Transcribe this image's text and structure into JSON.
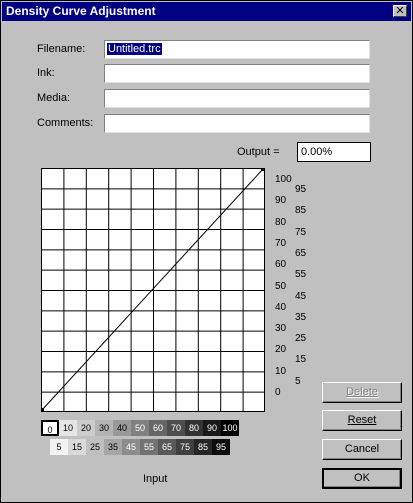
{
  "window": {
    "title": "Density Curve Adjustment",
    "close_glyph": "✕"
  },
  "fields": {
    "filename": {
      "label": "Filename:",
      "value": "Untitled.trc"
    },
    "ink": {
      "label": "Ink:",
      "value": ""
    },
    "media": {
      "label": "Media:",
      "value": ""
    },
    "comments": {
      "label": "Comments:",
      "value": ""
    }
  },
  "output": {
    "label": "Output =",
    "value": "0.00%"
  },
  "curve": {
    "points": [
      [
        0,
        0
      ],
      [
        100,
        100
      ]
    ],
    "y_ticks_main": [
      "100",
      "90",
      "80",
      "70",
      "60",
      "50",
      "40",
      "30",
      "20",
      "10",
      "0"
    ],
    "y_ticks_alt": [
      "95",
      "85",
      "75",
      "65",
      "55",
      "45",
      "35",
      "25",
      "15",
      "5"
    ]
  },
  "gray_scale": {
    "top": [
      "0",
      "10",
      "20",
      "30",
      "40",
      "50",
      "60",
      "70",
      "80",
      "90",
      "100"
    ],
    "bottom": [
      "5",
      "15",
      "25",
      "35",
      "45",
      "55",
      "65",
      "75",
      "85",
      "95"
    ]
  },
  "input_label": "Input",
  "buttons": {
    "delete": {
      "label": "Delete",
      "enabled": false
    },
    "reset": {
      "label": "Reset"
    },
    "cancel": {
      "label": "Cancel"
    },
    "ok": {
      "label": "OK"
    }
  }
}
